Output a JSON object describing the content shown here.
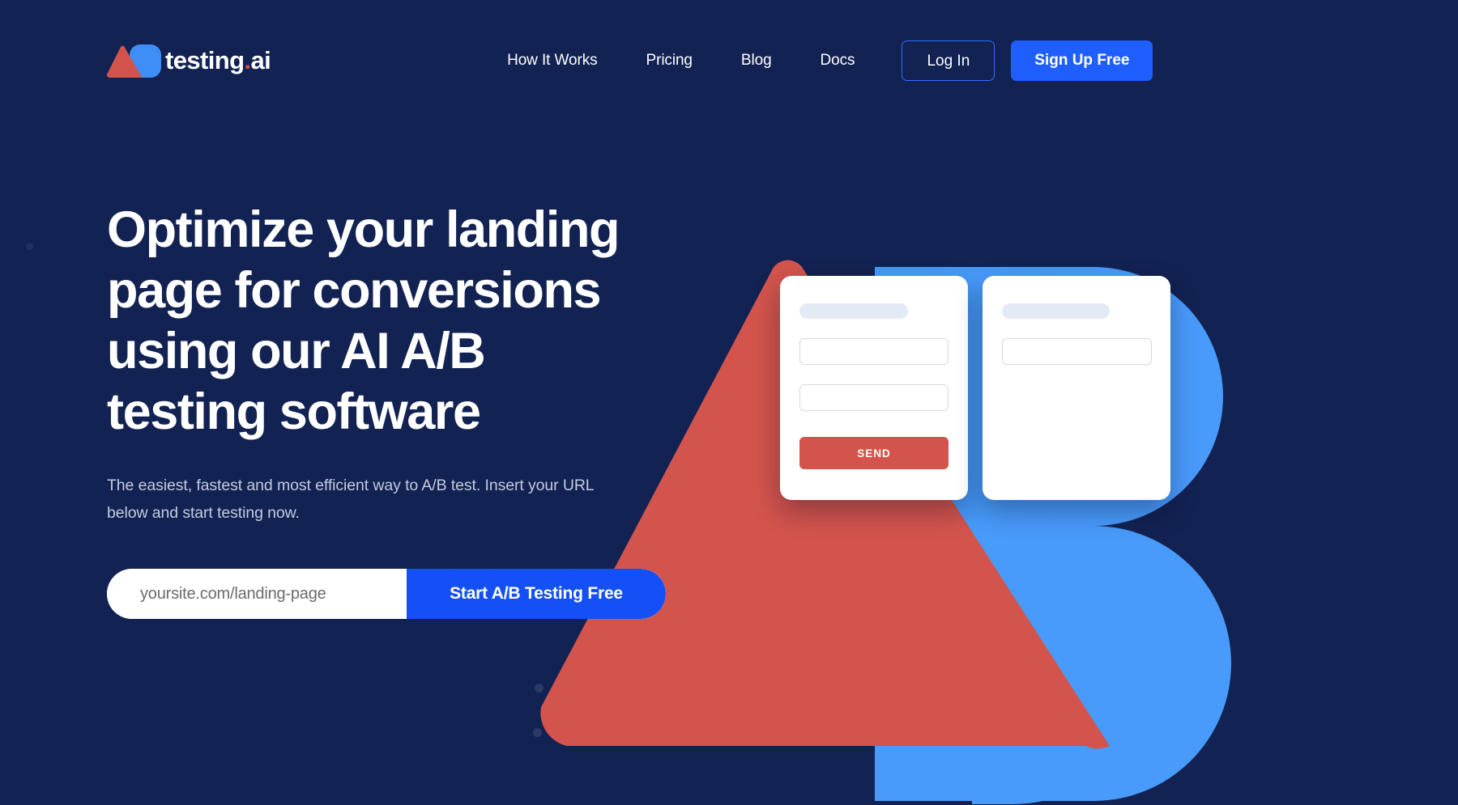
{
  "brand": {
    "logo_text": "testing",
    "logo_suffix_dot": ".",
    "logo_suffix": "ai",
    "logo_mark_a_icon": "red-triangle-a-icon",
    "logo_mark_b_icon": "blue-rounded-b-icon",
    "colors": {
      "background_navy": "#122252",
      "accent_blue": "#1f5eff",
      "art_blue": "#489bfb",
      "art_red": "#d3544d",
      "cta_blue": "#1450f5",
      "logo_dot_red": "#d7504a"
    }
  },
  "nav": {
    "items": [
      {
        "label": "How It Works"
      },
      {
        "label": "Pricing"
      },
      {
        "label": "Blog"
      },
      {
        "label": "Docs"
      }
    ],
    "login_label": "Log In",
    "signup_label": "Sign Up Free"
  },
  "hero": {
    "title": "Optimize your landing page for conversions using our AI A/B testing software",
    "subtitle": "The easiest, fastest and most efficient way to A/B test. Insert your URL below and start testing now.",
    "cta": {
      "input_value": "",
      "input_placeholder": "yoursite.com/landing-page",
      "button_label": "Start A/B Testing Free"
    }
  },
  "illustration": {
    "variant_a": {
      "heading_placeholder": "",
      "field_1": "",
      "field_2": "",
      "submit_label": "SEND"
    },
    "variant_b": {
      "heading_placeholder": "",
      "field_1": ""
    },
    "background_letter_a": "A",
    "background_letter_b": "B"
  }
}
